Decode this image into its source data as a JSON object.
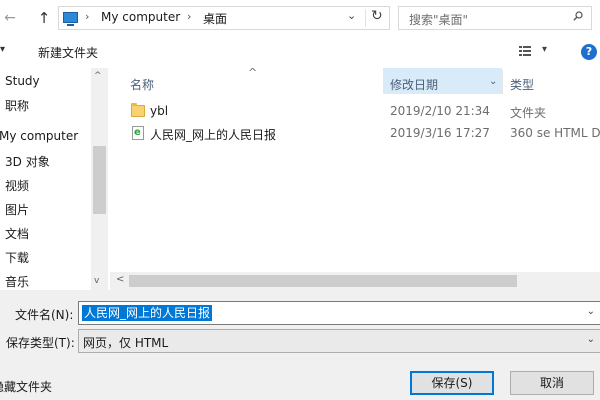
{
  "address": {
    "crumbs": [
      "My computer",
      "桌面"
    ],
    "search_placeholder": "搜索\"桌面\""
  },
  "toolbar": {
    "new_folder_label": "新建文件夹"
  },
  "navpane": {
    "items": [
      "Study",
      "职称",
      "My computer",
      "3D 对象",
      "视频",
      "图片",
      "文档",
      "下载",
      "音乐"
    ]
  },
  "content": {
    "columns": {
      "name": "名称",
      "date": "修改日期",
      "type": "类型"
    },
    "rows": [
      {
        "name": "ybl",
        "date": "2019/2/10 21:34",
        "type": "文件夹",
        "icon": "folder-icon"
      },
      {
        "name": "人民网_网上的人民日报",
        "date": "2019/3/16 17:27",
        "type": "360 se HTML D",
        "icon": "html-file-icon"
      }
    ]
  },
  "bottom": {
    "filename_label": "文件名(N):",
    "filename_value": "人民网_网上的人民日报",
    "filetype_label": "保存类型(T):",
    "filetype_value": "网页，仅 HTML",
    "hide_folders_label": "隐藏文件夹",
    "save_label": "保存(S)",
    "cancel_label": "取消"
  },
  "colors": {
    "accent": "#0078d7",
    "column_highlight": "#d9ebf9",
    "header_text": "#4c607a"
  }
}
